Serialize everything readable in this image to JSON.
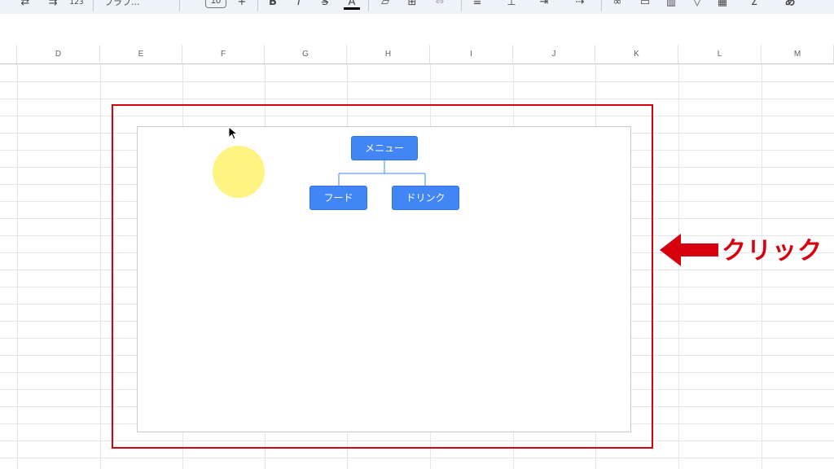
{
  "toolbar": {
    "font_name": "フラフ...",
    "font_size": "10",
    "language_button": "あ",
    "icons": [
      "undo-icon",
      "redo-icon",
      "format-123-icon",
      "font-size-increase-icon",
      "bold-icon",
      "italic-icon",
      "strikethrough-icon",
      "text-color-icon",
      "fill-color-icon",
      "borders-icon",
      "merge-icon",
      "align-left-icon",
      "vertical-align-icon",
      "text-wrap-icon",
      "text-rotate-icon",
      "link-icon",
      "comment-icon",
      "chart-icon",
      "filter-icon",
      "filter-views-icon",
      "functions-icon"
    ]
  },
  "sheet": {
    "columns": [
      "D",
      "E",
      "F",
      "G",
      "H",
      "I",
      "J",
      "K",
      "L",
      "M"
    ]
  },
  "drawing": {
    "nodes": {
      "root": "メニュー",
      "child_left": "フード",
      "child_right": "ドリンク"
    },
    "node_color": "#4285f4"
  },
  "annotation": {
    "callout_text": "クリック",
    "accent_color": "#d7000f"
  },
  "cursor_halo_color": "#fff37a"
}
